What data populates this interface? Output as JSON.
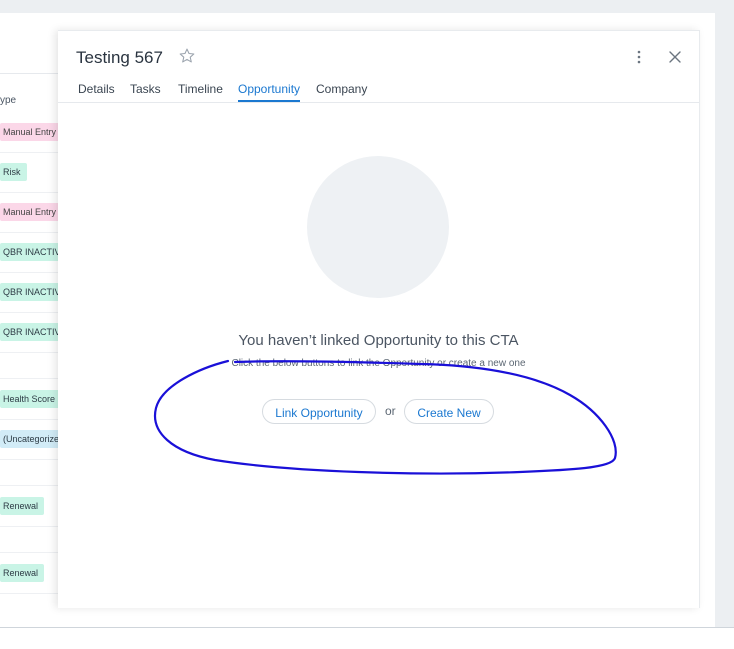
{
  "background_list": {
    "header": "ype",
    "rows": [
      {
        "tag": "Manual Entry",
        "color": "pink"
      },
      {
        "tag": "Risk",
        "color": "green"
      },
      {
        "tag": "Manual Entry",
        "color": "pink"
      },
      {
        "tag": "QBR INACTIV",
        "color": "green"
      },
      {
        "tag": "QBR INACTIV",
        "color": "green"
      },
      {
        "tag": "QBR INACTIV",
        "color": "green"
      },
      {
        "tag": "",
        "color": ""
      },
      {
        "tag": "Health Score",
        "color": "green"
      },
      {
        "tag": "(Uncategorize",
        "color": "blue"
      },
      {
        "tag": "",
        "color": ""
      },
      {
        "tag": "Renewal",
        "color": "green"
      },
      {
        "tag": "",
        "color": ""
      },
      {
        "tag": "Renewal",
        "color": "green"
      }
    ]
  },
  "drawer": {
    "title": "Testing 567",
    "tabs": [
      {
        "label": "Details",
        "active": false
      },
      {
        "label": "Tasks",
        "active": false
      },
      {
        "label": "Timeline",
        "active": false
      },
      {
        "label": "Opportunity",
        "active": true
      },
      {
        "label": "Company",
        "active": false
      }
    ],
    "empty_state": {
      "title": "You haven’t linked Opportunity to this CTA",
      "subtitle": "Click the below buttons to link the Opportunity or create a new one",
      "link_button": "Link Opportunity",
      "or_text": "or",
      "create_button": "Create New"
    }
  },
  "colors": {
    "accent": "#1b78d0",
    "annotation": "#1a10d8"
  }
}
